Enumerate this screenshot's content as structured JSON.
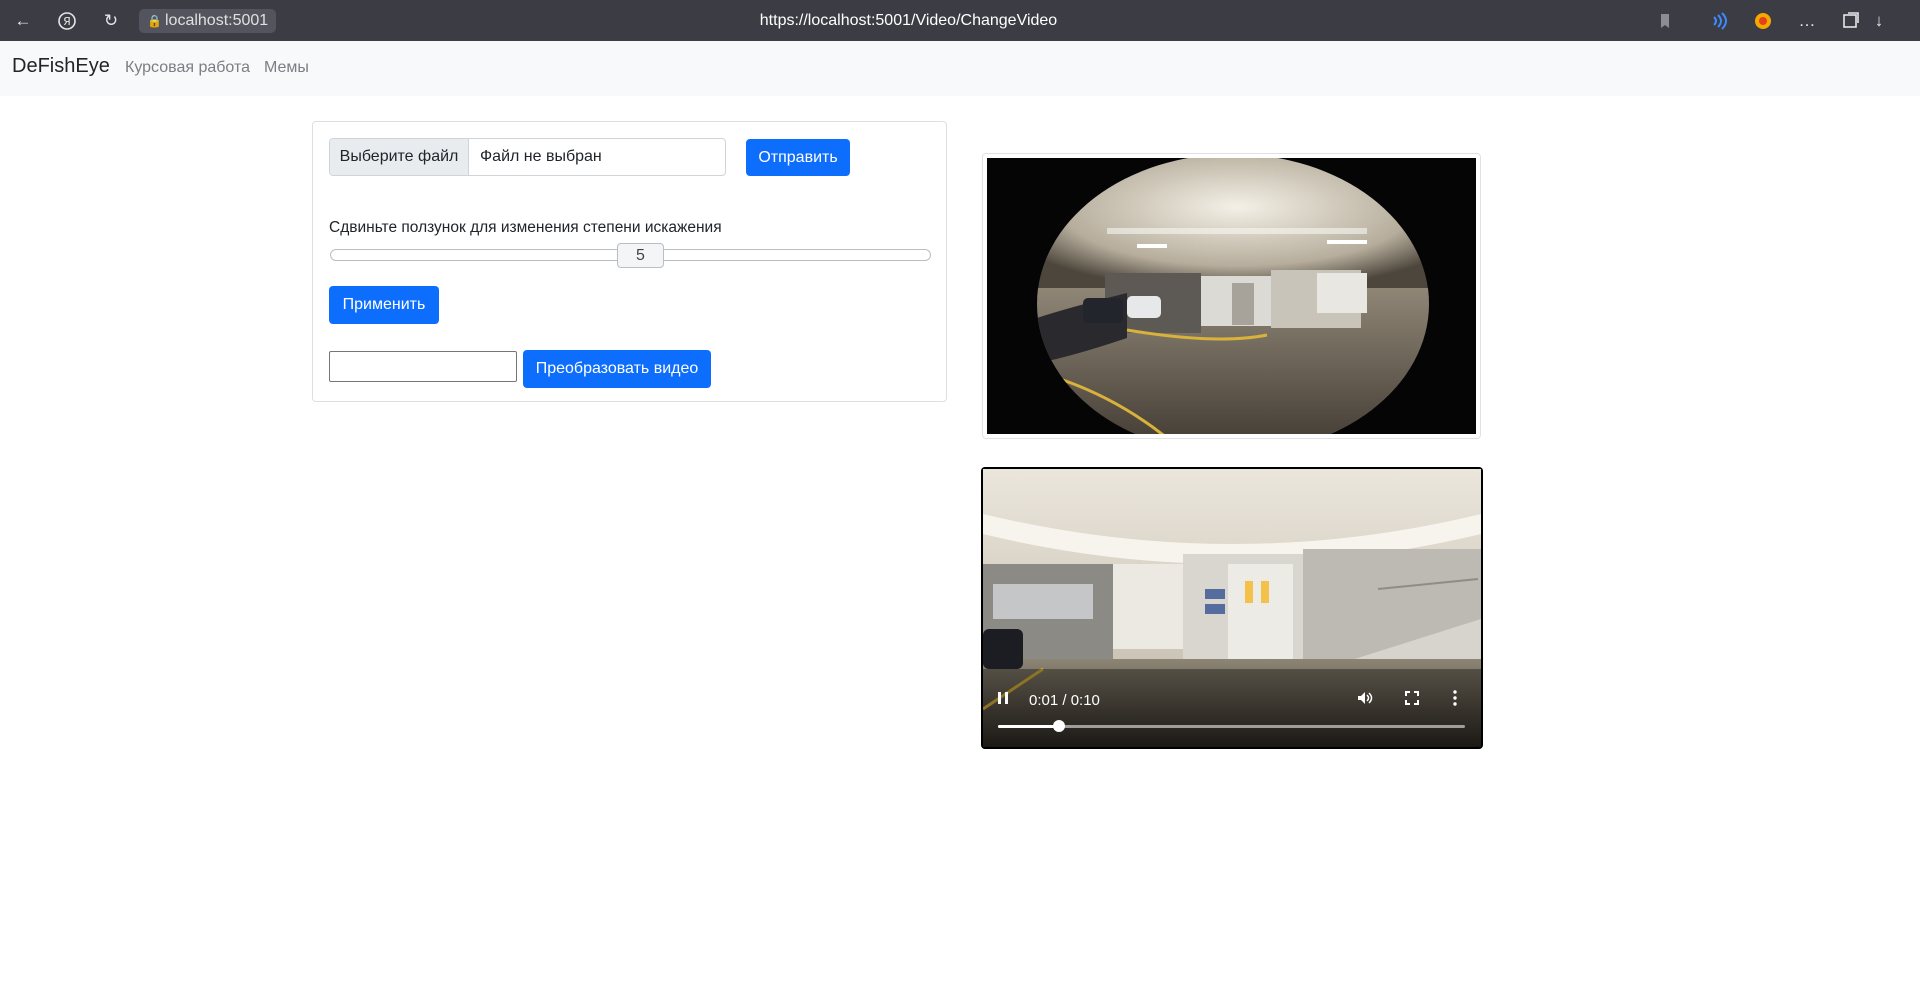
{
  "browser": {
    "host": "localhost:5001",
    "url": "https://localhost:5001/Video/ChangeVideo"
  },
  "navbar": {
    "brand": "DeFishEye",
    "links": [
      "Курсовая работа",
      "Мемы"
    ]
  },
  "form": {
    "file_button": "Выберите файл",
    "file_name": "Файл не выбран",
    "submit_label": "Отправить",
    "slider_label": "Сдвиньте ползунок для изменения степени искажения",
    "slider_value": "5",
    "apply_label": "Применить",
    "path_value": "",
    "convert_label": "Преобразовать видео"
  },
  "video": {
    "time": "0:01 / 0:10",
    "progress": 0.13
  },
  "colors": {
    "primary": "#0d6efd",
    "chrome": "#3c3c45",
    "navbar": "#f8f9fa"
  }
}
